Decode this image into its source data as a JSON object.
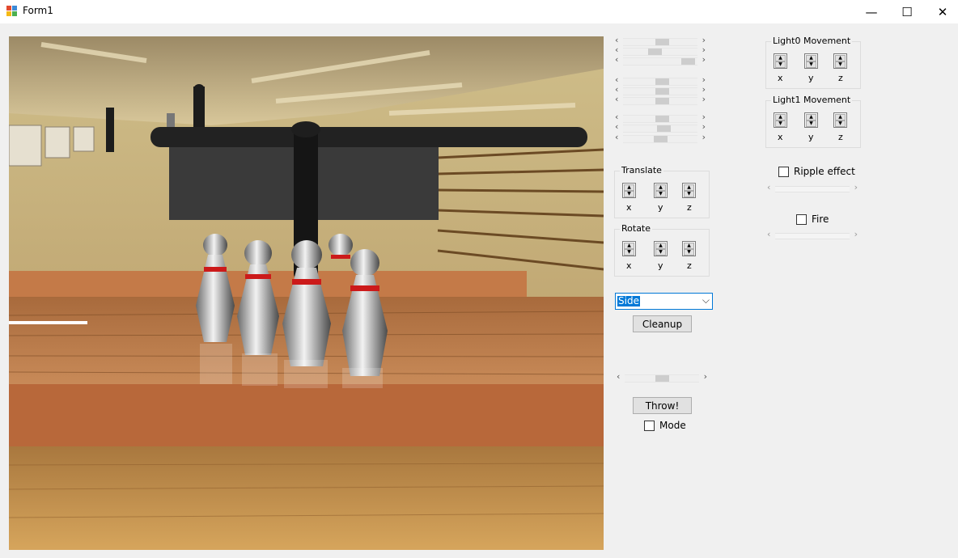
{
  "window": {
    "title": "Form1",
    "minimize_glyph": "—",
    "maximize_glyph": "☐",
    "close_glyph": "✕"
  },
  "scene": {
    "description_icons": [
      "bowling-pin",
      "sweep-bar"
    ]
  },
  "sliders": {
    "arrow_left": "‹",
    "arrow_right": "›"
  },
  "translate": {
    "label": "Translate",
    "x": "x",
    "y": "y",
    "z": "z"
  },
  "rotate": {
    "label": "Rotate",
    "x": "x",
    "y": "y",
    "z": "z"
  },
  "camera_select": {
    "value": "Side",
    "arrow": "⌵"
  },
  "cleanup": {
    "label": "Cleanup"
  },
  "throw": {
    "label": "Throw!"
  },
  "mode": {
    "label": "Mode",
    "checked": false
  },
  "light0": {
    "label": "Light0 Movement",
    "x": "x",
    "y": "y",
    "z": "z"
  },
  "light1": {
    "label": "Light1 Movement",
    "x": "x",
    "y": "y",
    "z": "z"
  },
  "ripple": {
    "label": "Ripple effect",
    "checked": false
  },
  "fire": {
    "label": "Fire",
    "checked": false
  },
  "spinner": {
    "up": "▲",
    "down": "▼"
  },
  "colors": {
    "lane_front": "#b8683a",
    "floor_wood": "#c89555",
    "pin_stripe": "#cc1a1a",
    "sweeper": "#2e2e2e",
    "selection": "#0078d7"
  }
}
